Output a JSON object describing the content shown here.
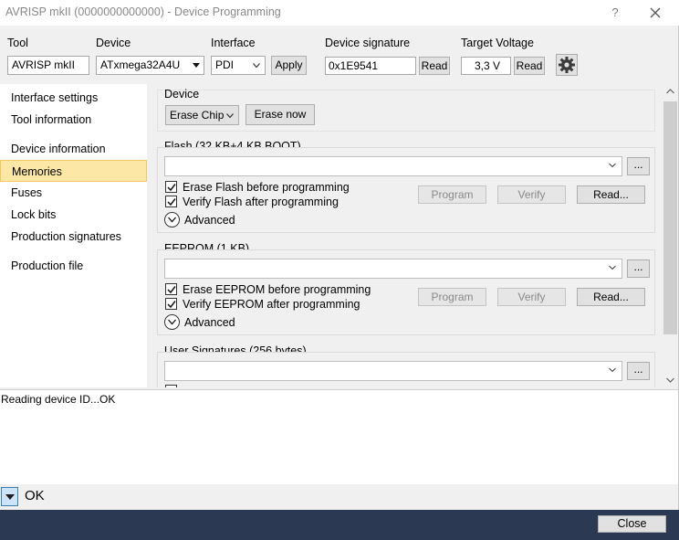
{
  "window": {
    "title": "AVRISP mkII (0000000000000) - Device Programming",
    "help_glyph": "?",
    "close_icon": "close-icon"
  },
  "toolbar": {
    "tool_label": "Tool",
    "tool_value": "AVRISP mkII",
    "device_label": "Device",
    "device_value": "ATxmega32A4U",
    "interface_label": "Interface",
    "interface_value": "PDI",
    "apply_label": "Apply",
    "signature_label": "Device signature",
    "signature_value": "0x1E9541",
    "signature_read_label": "Read",
    "voltage_label": "Target Voltage",
    "voltage_value": "3,3 V",
    "voltage_read_label": "Read",
    "settings_icon": "gear-icon"
  },
  "sidebar": {
    "items": [
      {
        "label": "Interface settings",
        "active": false
      },
      {
        "label": "Tool information",
        "active": false
      },
      {
        "label": "Device information",
        "active": false
      },
      {
        "label": "Memories",
        "active": true
      },
      {
        "label": "Fuses",
        "active": false
      },
      {
        "label": "Lock bits",
        "active": false
      },
      {
        "label": "Production signatures",
        "active": false
      },
      {
        "label": "Production file",
        "active": false
      }
    ]
  },
  "device_group": {
    "title": "Device",
    "erase_mode": "Erase Chip",
    "erase_now_label": "Erase now"
  },
  "flash_group": {
    "title": "Flash (32 KB+4 KB BOOT)",
    "file_value": "",
    "browse_label": "...",
    "erase_before_label": "Erase Flash before programming",
    "erase_before_checked": true,
    "verify_after_label": "Verify Flash after programming",
    "verify_after_checked": true,
    "program_label": "Program",
    "verify_label": "Verify",
    "read_label": "Read...",
    "advanced_label": "Advanced"
  },
  "eeprom_group": {
    "title": "EEPROM (1 KB)",
    "file_value": "",
    "browse_label": "...",
    "erase_before_label": "Erase EEPROM before programming",
    "erase_before_checked": true,
    "verify_after_label": "Verify EEPROM after programming",
    "verify_after_checked": true,
    "program_label": "Program",
    "verify_label": "Verify",
    "read_label": "Read...",
    "advanced_label": "Advanced"
  },
  "usersig_group": {
    "title": "User Signatures (256 bytes)",
    "file_value": "",
    "browse_label": "..."
  },
  "log": {
    "text": "Reading device ID...OK"
  },
  "status": {
    "text": "OK"
  },
  "footer": {
    "close_label": "Close"
  },
  "colors": {
    "active_nav_bg": "#fce7a6",
    "footer_bg": "#2b3a52",
    "status_toggle_bg": "#cde3f7"
  }
}
